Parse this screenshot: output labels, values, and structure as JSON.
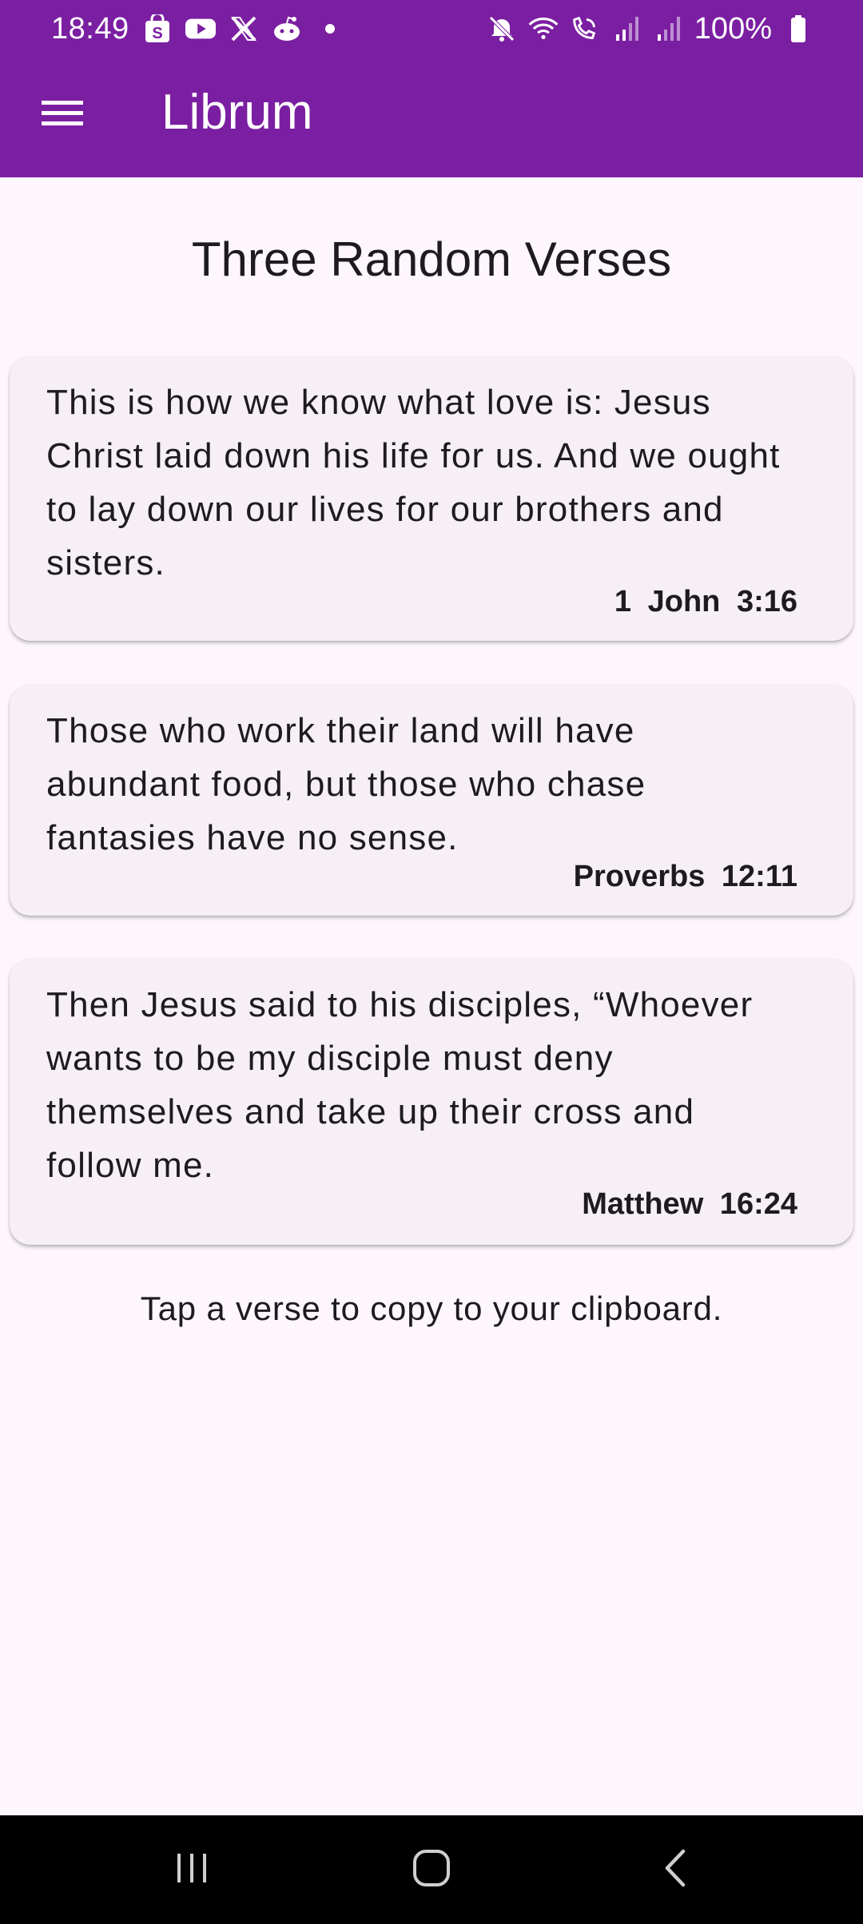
{
  "status_bar": {
    "time": "18:49",
    "notification_icons": [
      "shopping-bag-icon",
      "youtube-icon",
      "x-icon",
      "reddit-icon",
      "dot-icon"
    ],
    "system_icons": [
      "mute-icon",
      "wifi-icon",
      "wifi-calling-icon",
      "signal-icon",
      "signal-icon"
    ],
    "battery": "100%"
  },
  "app_bar": {
    "title": "Librum",
    "menu_icon": "hamburger-menu-icon",
    "color": "#7b1fa2"
  },
  "main": {
    "title": "Three Random Verses",
    "verses": [
      {
        "text": "This is how we know what love is: Jesus Christ laid down his life for us. And we ought to lay down our lives for our brothers and sisters.",
        "reference": "1 John 3:16"
      },
      {
        "text": "Those who work their land will have abundant food, but those who chase fantasies have no sense.",
        "reference": "Proverbs 12:11"
      },
      {
        "text": "Then Jesus said to his disciples, “Whoever wants to be my disciple must deny themselves and take up their cross and follow me.",
        "reference": "Matthew 16:24"
      }
    ],
    "hint": "Tap a verse to copy to your clipboard."
  },
  "nav_bar": {
    "buttons": [
      "recent-apps-icon",
      "home-icon",
      "back-icon"
    ]
  }
}
